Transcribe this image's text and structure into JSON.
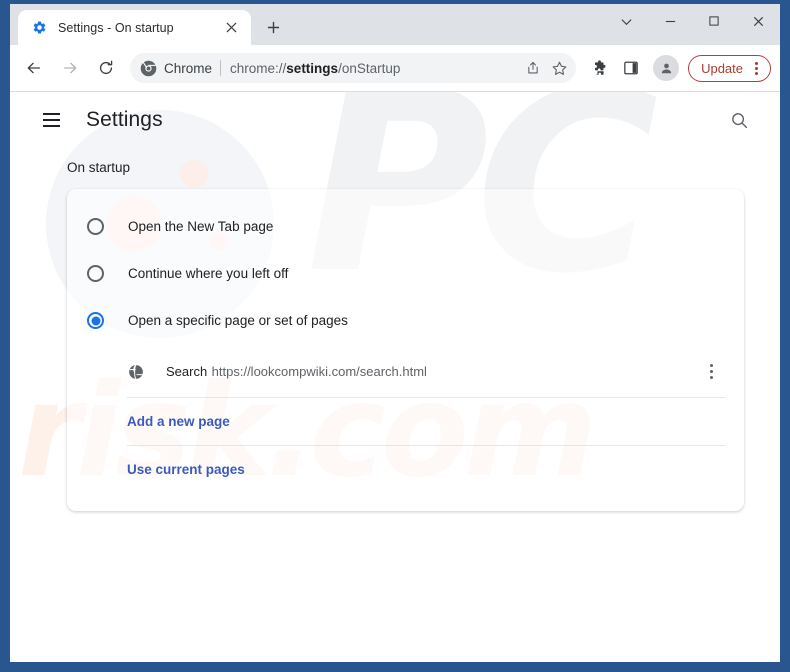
{
  "window": {
    "caption_buttons": [
      {
        "name": "chevron-down",
        "label": "⌄"
      },
      {
        "name": "minimize",
        "label": "–"
      },
      {
        "name": "maximize",
        "label": "□"
      },
      {
        "name": "close",
        "label": "✕"
      }
    ]
  },
  "tab": {
    "title": "Settings - On startup",
    "favicon": "gear-icon",
    "close_label": "✕",
    "new_tab_label": "+"
  },
  "toolbar": {
    "back_label": "←",
    "forward_label": "→",
    "reload_label": "↻",
    "omnibox": {
      "chrome_label": "Chrome",
      "url_prefix": "chrome://",
      "url_bold": "settings",
      "url_suffix": "/onStartup",
      "full_url": "chrome://settings/onStartup",
      "share_icon": "share-icon",
      "bookmark_icon": "star-icon"
    },
    "extensions_icon": "puzzle-icon",
    "side_panel_icon": "side-panel-icon",
    "avatar_icon": "profile-avatar-icon",
    "update_label": "Update",
    "update_color": "#a83c32"
  },
  "settings": {
    "menu_label": "hamburger-menu-icon",
    "title": "Settings",
    "search_icon": "search-icon",
    "section_label": "On startup",
    "accent_color": "#1a73e8",
    "link_color": "#3a5bbd",
    "options": [
      {
        "label": "Open the New Tab page",
        "selected": false
      },
      {
        "label": "Continue where you left off",
        "selected": false
      },
      {
        "label": "Open a specific page or set of pages",
        "selected": true
      }
    ],
    "startup_page": {
      "favicon": "globe-icon",
      "title": "Search",
      "url": "https://lookcompwiki.com/search.html",
      "menu_icon": "more-vert-icon"
    },
    "actions": [
      {
        "label": "Add a new page",
        "name": "add-a-new-page-link"
      },
      {
        "label": "Use current pages",
        "name": "use-current-pages-link"
      }
    ]
  },
  "watermark": {
    "primary": "PC",
    "secondary": "risk.com",
    "primary_color": "#f1f2f3",
    "secondary_color": "#fdf1ea"
  }
}
